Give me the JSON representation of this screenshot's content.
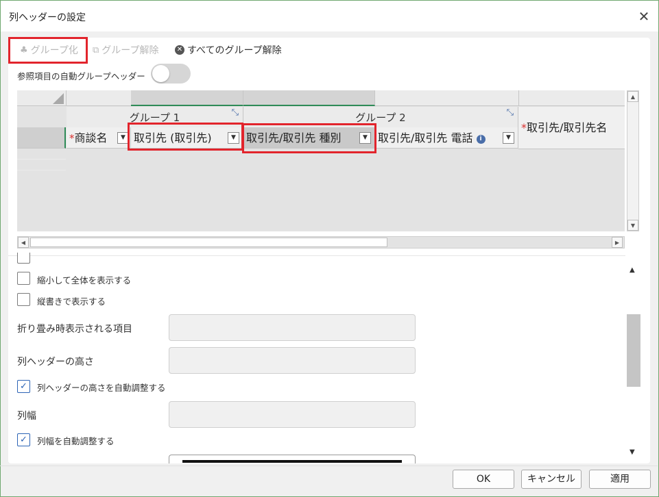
{
  "dialog": {
    "title": "列ヘッダーの設定"
  },
  "toolbar": {
    "group_label": "グループ化",
    "ungroup_label": "グループ解除",
    "ungroup_all_label": "すべてのグループ解除"
  },
  "auto_group": {
    "label": "参照項目の自動グループヘッダー",
    "enabled": false
  },
  "grid": {
    "groups": [
      {
        "label": "グループ 1"
      },
      {
        "label": "グループ 2"
      }
    ],
    "columns": [
      {
        "label": "商談名",
        "required": true
      },
      {
        "label": "取引先 (取引先)",
        "required": false
      },
      {
        "label": "取引先/取引先 種別",
        "required": false
      },
      {
        "label": "取引先/取引先 電話",
        "required": false,
        "info": "i"
      },
      {
        "label": "取引先/取引先名",
        "required": true
      }
    ],
    "required_mark": "*"
  },
  "properties": {
    "fit_all_label": "縮小して全体を表示する",
    "vertical_label": "縦書きで表示する",
    "collapsed_item_label": "折り畳み時表示される項目",
    "header_height_label": "列ヘッダーの高さ",
    "auto_header_height_label": "列ヘッダーの高さを自動調整する",
    "column_width_label": "列幅",
    "auto_column_width_label": "列幅を自動調整する",
    "check_mark": "✓"
  },
  "buttons": {
    "ok": "OK",
    "cancel": "キャンセル",
    "apply": "適用"
  }
}
